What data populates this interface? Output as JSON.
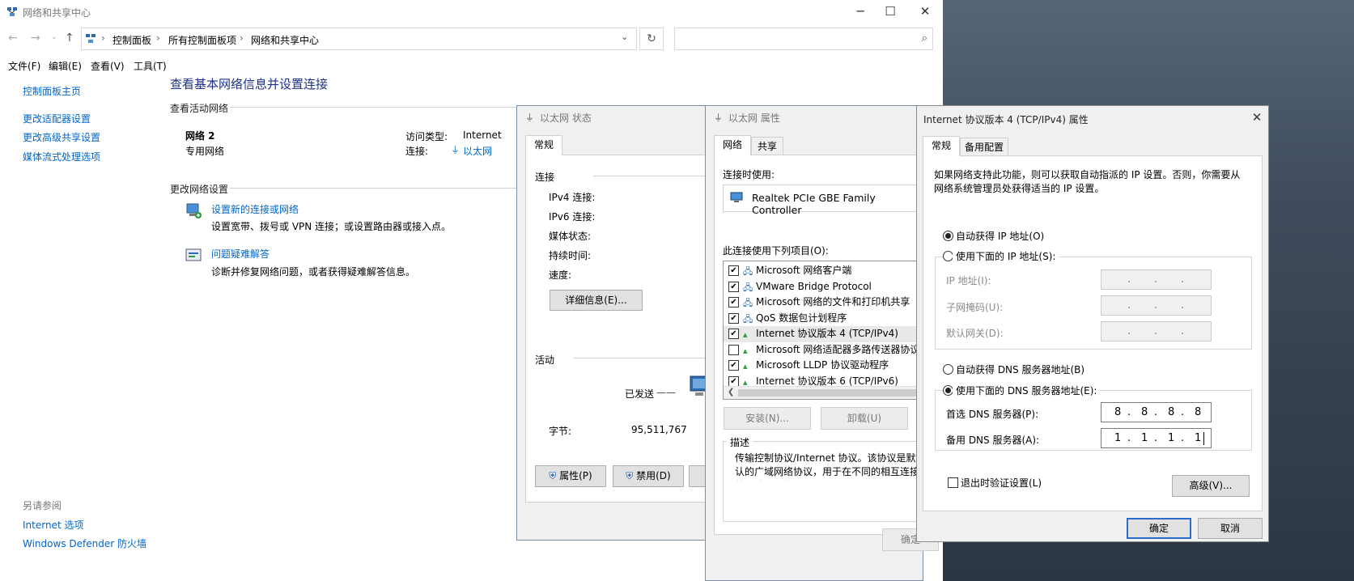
{
  "main": {
    "title": "网络和共享中心",
    "breadcrumb": [
      "控制面板",
      "所有控制面板项",
      "网络和共享中心"
    ],
    "menu": [
      "文件(F)",
      "编辑(E)",
      "查看(V)",
      "工具(T)"
    ],
    "sidebar": {
      "items": [
        "控制面板主页",
        "更改适配器设置",
        "更改高级共享设置",
        "媒体流式处理选项"
      ],
      "see_also": "另请参阅",
      "see_also_items": [
        "Internet 选项",
        "Windows Defender 防火墙"
      ]
    },
    "heading": "查看基本网络信息并设置连接",
    "active_label": "查看活动网络",
    "net_name": "网络 2",
    "net_type": "专用网络",
    "access_label": "访问类型:",
    "access_value": "Internet",
    "conn_label": "连接:",
    "conn_value": "以太网",
    "change_label": "更改网络设置",
    "tasks": [
      {
        "title": "设置新的连接或网络",
        "desc": "设置宽带、拨号或 VPN 连接；或设置路由器或接入点。"
      },
      {
        "title": "问题疑难解答",
        "desc": "诊断并修复网络问题，或者获得疑难解答信息。"
      }
    ]
  },
  "status": {
    "title": "以太网 状态",
    "tab": "常规",
    "conn_group": "连接",
    "rows": [
      "IPv4 连接:",
      "IPv6 连接:",
      "媒体状态:",
      "持续时间:",
      "速度:"
    ],
    "details_btn": "详细信息(E)...",
    "act_group": "活动",
    "sent_label": "已发送",
    "bytes_label": "字节:",
    "bytes_sent": "95,511,767",
    "btn_props": "属性(P)",
    "btn_disable": "禁用(D)"
  },
  "props": {
    "title": "以太网 属性",
    "tabs": [
      "网络",
      "共享"
    ],
    "connect_using": "连接时使用:",
    "adapter": "Realtek PCIe GBE Family Controller",
    "uses_label": "此连接使用下列项目(O):",
    "items": [
      {
        "label": "Microsoft 网络客户端",
        "checked": true
      },
      {
        "label": "VMware Bridge Protocol",
        "checked": true
      },
      {
        "label": "Microsoft 网络的文件和打印机共享",
        "checked": true
      },
      {
        "label": "QoS 数据包计划程序",
        "checked": true
      },
      {
        "label": "Internet 协议版本 4 (TCP/IPv4)",
        "checked": true
      },
      {
        "label": "Microsoft 网络适配器多路传送器协议",
        "checked": false
      },
      {
        "label": "Microsoft LLDP 协议驱动程序",
        "checked": true
      },
      {
        "label": "Internet 协议版本 6 (TCP/IPv6)",
        "checked": true
      }
    ],
    "btn_install": "安装(N)...",
    "btn_uninstall": "卸载(U)",
    "desc_label": "描述",
    "desc_text": "传输控制协议/Internet 协议。该协议是默认的广域网络协议，用于在不同的相互连接的网络上通信。",
    "btn_ok": "确定"
  },
  "ipv4": {
    "title": "Internet 协议版本 4 (TCP/IPv4) 属性",
    "tabs": [
      "常规",
      "备用配置"
    ],
    "intro": "如果网络支持此功能，则可以获取自动指派的 IP 设置。否则，你需要从网络系统管理员处获得适当的 IP 设置。",
    "auto_ip": "自动获得 IP 地址(O)",
    "manual_ip": "使用下面的 IP 地址(S):",
    "ip_label": "IP 地址(I):",
    "mask_label": "子网掩码(U):",
    "gw_label": "默认网关(D):",
    "auto_dns": "自动获得 DNS 服务器地址(B)",
    "manual_dns": "使用下面的 DNS 服务器地址(E):",
    "dns1_label": "首选 DNS 服务器(P):",
    "dns1": [
      "8",
      "8",
      "8",
      "8"
    ],
    "dns2_label": "备用 DNS 服务器(A):",
    "dns2": [
      "1",
      "1",
      "1",
      "1"
    ],
    "validate": "退出时验证设置(L)",
    "btn_adv": "高级(V)...",
    "btn_ok": "确定",
    "btn_cancel": "取消"
  }
}
